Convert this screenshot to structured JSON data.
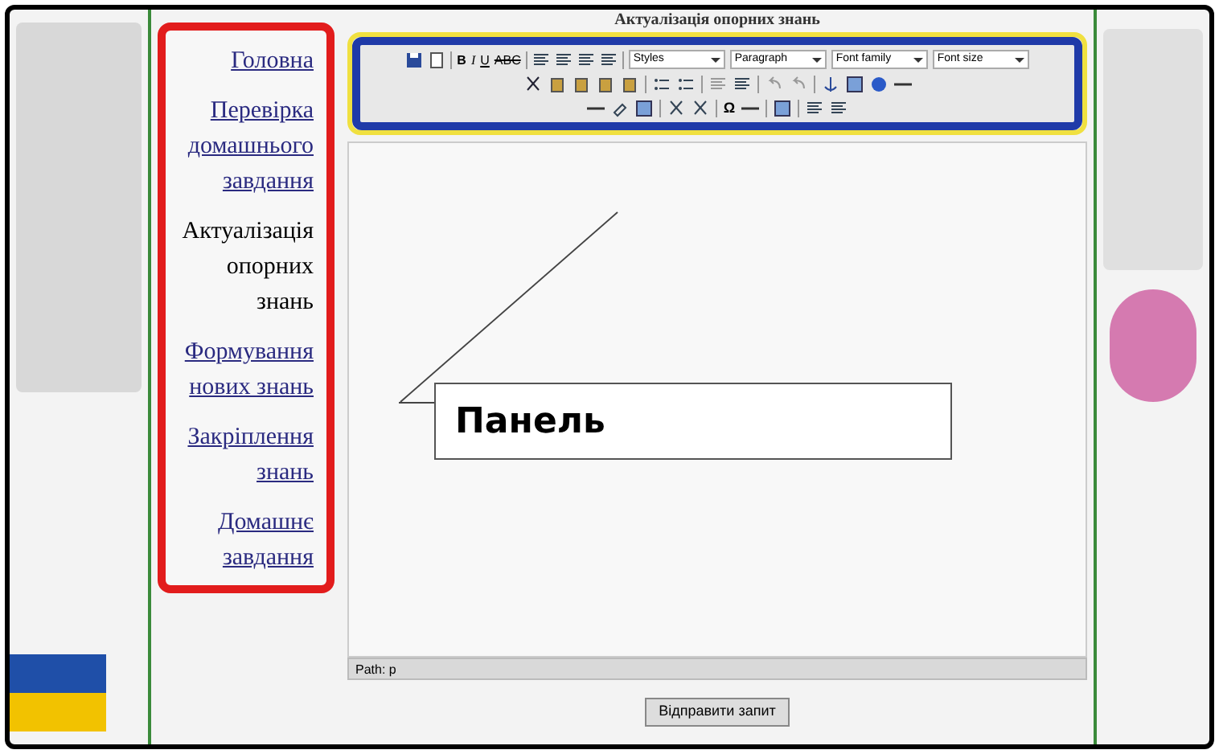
{
  "page_title": "Актуалізація опорних знань",
  "nav": [
    {
      "label": "Головна",
      "selected": false
    },
    {
      "label": "Перевірка домашнього завдання",
      "selected": false
    },
    {
      "label": "Актуалізація опорних знань",
      "selected": true
    },
    {
      "label": "Формування нових знань",
      "selected": false
    },
    {
      "label": "Закріплення знань",
      "selected": false
    },
    {
      "label": "Домашнє завдання",
      "selected": false
    }
  ],
  "toolbar": {
    "format_buttons": [
      "B",
      "I",
      "U",
      "ABC"
    ],
    "selects": [
      "Styles",
      "Paragraph",
      "Font family",
      "Font size"
    ],
    "special_char": "Ω"
  },
  "callout": "Панель",
  "path_bar": "Path: p",
  "submit_button": "Відправити запит"
}
